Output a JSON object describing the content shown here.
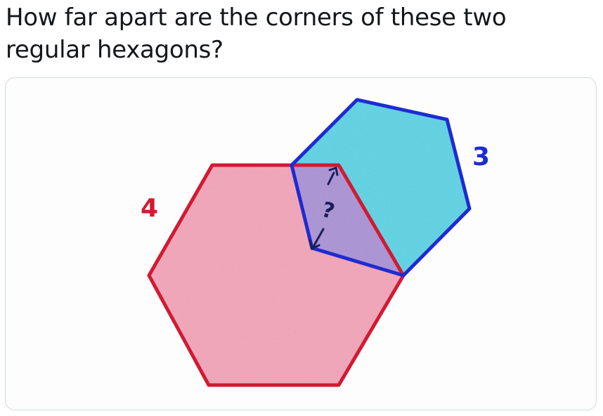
{
  "tweet": {
    "text": "How far apart are the corners of these two regular hexagons?"
  },
  "figure": {
    "large_hexagon_label": "4",
    "small_hexagon_label": "3",
    "question_label": "?",
    "colors": {
      "large_outline": "#d11a33",
      "large_fill": "#f5a3b8",
      "small_outline": "#1f2bd1",
      "small_fill": "#4fd4e6",
      "overlap_fill": "#a98fd6",
      "arrow": "#1a1f5c"
    }
  }
}
